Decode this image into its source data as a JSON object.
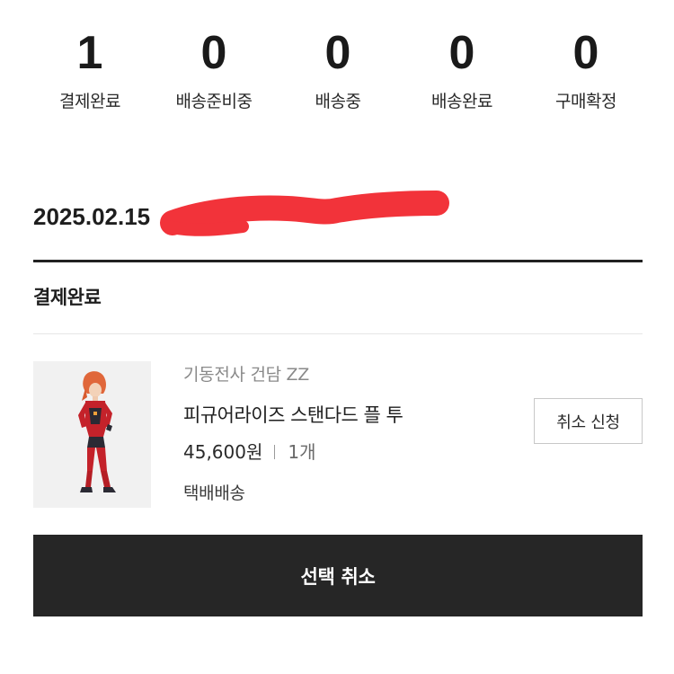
{
  "summary": {
    "items": [
      {
        "count": "1",
        "label": "결제완료"
      },
      {
        "count": "0",
        "label": "배송준비중"
      },
      {
        "count": "0",
        "label": "배송중"
      },
      {
        "count": "0",
        "label": "배송완료"
      },
      {
        "count": "0",
        "label": "구매확정"
      }
    ]
  },
  "order": {
    "date": "2025.02.15",
    "status": "결제완료"
  },
  "product": {
    "brand": "기동전사 건담 ZZ",
    "name": "피규어라이즈 스탠다드 플 투",
    "price": "45,600원",
    "quantity": "1개",
    "shipping": "택배배송",
    "cancel_request_label": "취소 신청"
  },
  "actions": {
    "cancel_selected_label": "선택 취소"
  },
  "colors": {
    "redaction": "#f2333a",
    "primary_button": "#262626"
  }
}
